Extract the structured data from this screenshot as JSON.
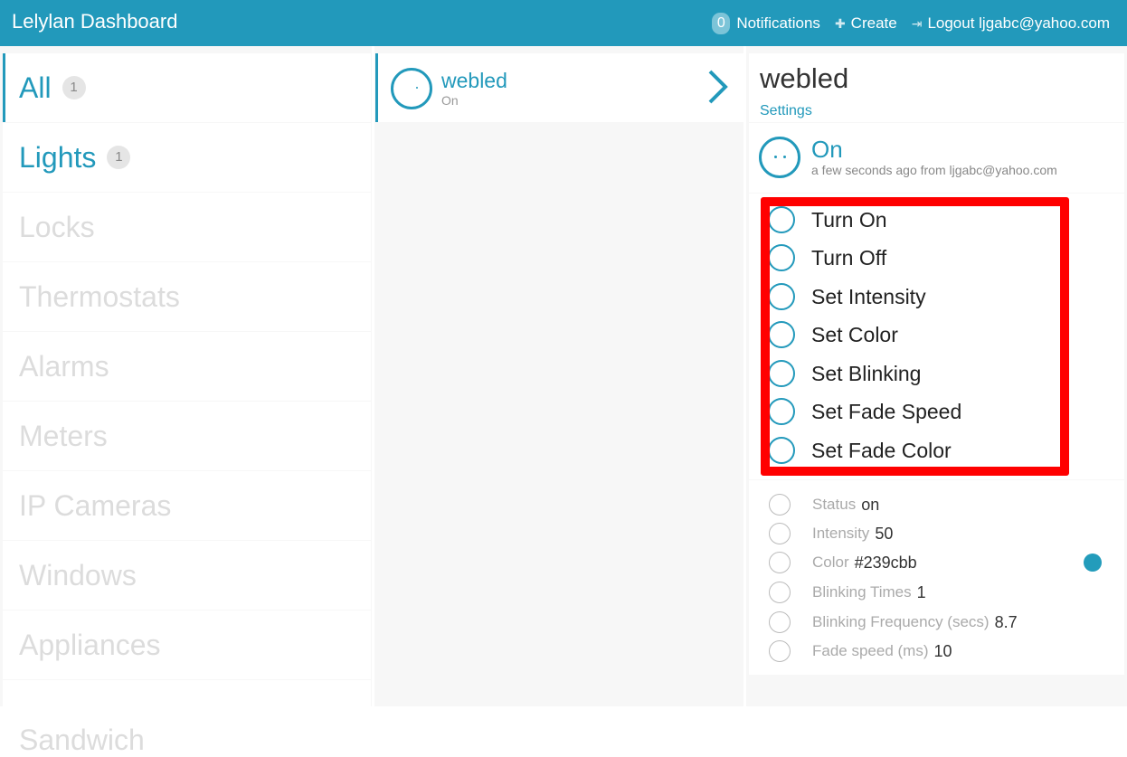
{
  "header": {
    "brand": "Lelylan Dashboard",
    "notifications_count": "0",
    "notifications_label": "Notifications",
    "create_label": "Create",
    "logout_label": "Logout ljgabc@yahoo.com"
  },
  "categories": [
    {
      "label": "All",
      "count": "1"
    },
    {
      "label": "Lights",
      "count": "1"
    },
    {
      "label": "Locks"
    },
    {
      "label": "Thermostats"
    },
    {
      "label": "Alarms"
    },
    {
      "label": "Meters"
    },
    {
      "label": "IP Cameras"
    },
    {
      "label": "Windows"
    },
    {
      "label": "Appliances"
    },
    {
      "label": "Sandwich"
    }
  ],
  "device_list": {
    "name": "webled",
    "status": "On"
  },
  "device": {
    "name": "webled",
    "settings_label": "Settings",
    "status": "On",
    "status_meta": "a few seconds ago from ljgabc@yahoo.com",
    "actions": [
      "Turn On",
      "Turn Off",
      "Set Intensity",
      "Set Color",
      "Set Blinking",
      "Set Fade Speed",
      "Set Fade Color"
    ],
    "properties": [
      {
        "name": "Status",
        "value": "on"
      },
      {
        "name": "Intensity",
        "value": "50"
      },
      {
        "name": "Color",
        "value": "#239cbb"
      },
      {
        "name": "Blinking Times",
        "value": "1"
      },
      {
        "name": "Blinking Frequency (secs)",
        "value": "8.7"
      },
      {
        "name": "Fade speed (ms)",
        "value": "10"
      }
    ]
  },
  "colors": {
    "accent": "#2299bb",
    "highlight": "#ff0000",
    "color_swatch": "#239cbb"
  }
}
